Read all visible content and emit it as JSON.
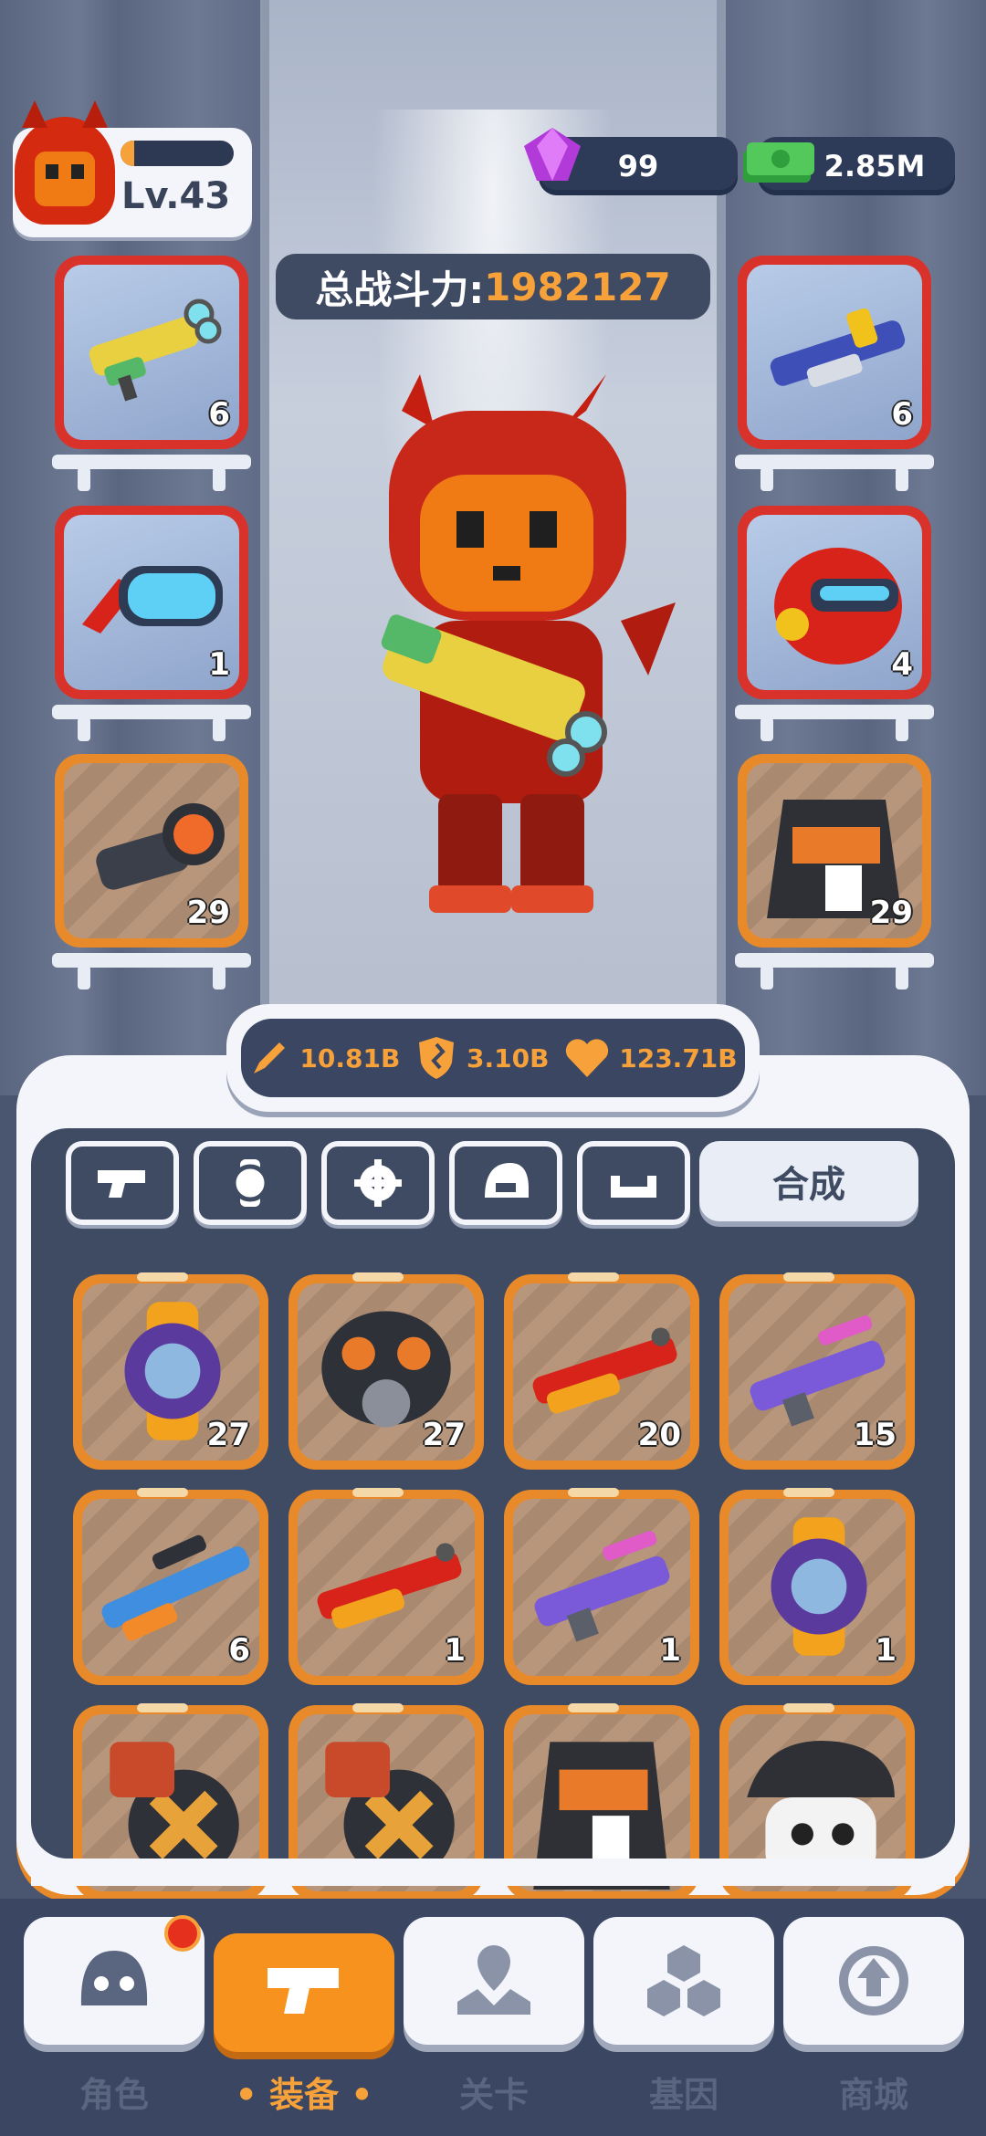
{
  "player": {
    "level": "Lv.43",
    "xp_fraction": 0.12
  },
  "currency": {
    "gems": "99",
    "cash": "2.85M"
  },
  "power": {
    "label": "总战斗力:",
    "value": "1982127"
  },
  "equipped": {
    "left": [
      {
        "name": "blaster-gun",
        "count": "6",
        "rarity": "red"
      },
      {
        "name": "goggles",
        "count": "1",
        "rarity": "red"
      },
      {
        "name": "scope",
        "count": "29",
        "rarity": "orange"
      }
    ],
    "right": [
      {
        "name": "shotgun",
        "count": "6",
        "rarity": "red"
      },
      {
        "name": "helmet",
        "count": "4",
        "rarity": "red"
      },
      {
        "name": "jacket",
        "count": "29",
        "rarity": "orange"
      }
    ]
  },
  "stats": {
    "attack": "10.81B",
    "defense": "3.10B",
    "health": "123.71B"
  },
  "tabs": {
    "icons": [
      "gun-icon",
      "watch-icon",
      "gear-icon",
      "helmet-icon",
      "armor-icon"
    ],
    "merge_label": "合成"
  },
  "inventory": [
    {
      "name": "watch-purple",
      "count": "27"
    },
    {
      "name": "gas-mask",
      "count": "27"
    },
    {
      "name": "shotgun-red",
      "count": "20"
    },
    {
      "name": "rifle-purple",
      "count": "15"
    },
    {
      "name": "sniper-blue",
      "count": "6"
    },
    {
      "name": "shotgun-red",
      "count": "1"
    },
    {
      "name": "rifle-purple",
      "count": "1"
    },
    {
      "name": "watch-purple",
      "count": "1"
    },
    {
      "name": "ammo-belt",
      "count": ""
    },
    {
      "name": "ammo-belt",
      "count": ""
    },
    {
      "name": "jacket",
      "count": ""
    },
    {
      "name": "skull-cap",
      "count": ""
    }
  ],
  "nav": [
    {
      "label": "角色",
      "icon": "character-icon"
    },
    {
      "label": "装备",
      "icon": "equipment-icon"
    },
    {
      "label": "关卡",
      "icon": "map-icon"
    },
    {
      "label": "基因",
      "icon": "gene-icon"
    },
    {
      "label": "商城",
      "icon": "shop-icon"
    }
  ],
  "colors": {
    "accent": "#f7a13a",
    "panel": "#3f4a63",
    "rare_red": "#d9322a",
    "rare_orange": "#e98a2a"
  }
}
